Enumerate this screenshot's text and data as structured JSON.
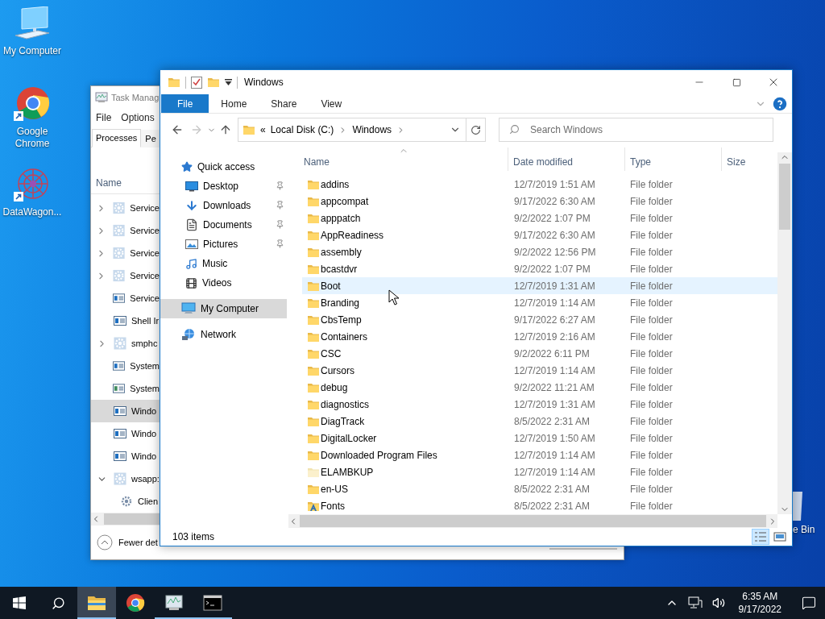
{
  "desktop_icons": [
    {
      "label": "My Computer",
      "kind": "computer"
    },
    {
      "label": "Google Chrome",
      "kind": "chrome"
    },
    {
      "label": "DataWagon...",
      "kind": "app"
    },
    {
      "label": "e Bin",
      "kind": "recycle"
    }
  ],
  "task_manager": {
    "title": "Task Manag",
    "menu": [
      "File",
      "Options"
    ],
    "tabs": [
      {
        "label": "Processes",
        "selected": true
      },
      {
        "label": "Pe",
        "selected": false
      }
    ],
    "column": "Name",
    "rows": [
      {
        "name": "Service",
        "kind": "group",
        "expanded": false,
        "selected": false
      },
      {
        "name": "Service",
        "kind": "group",
        "expanded": false,
        "selected": false
      },
      {
        "name": "Service",
        "kind": "group",
        "expanded": false,
        "selected": false
      },
      {
        "name": "Service",
        "kind": "group",
        "expanded": false,
        "selected": false
      },
      {
        "name": "Service",
        "kind": "app",
        "selected": false
      },
      {
        "name": "Shell Ir",
        "kind": "app",
        "selected": false
      },
      {
        "name": "smphc",
        "kind": "group",
        "expanded": false,
        "selected": false
      },
      {
        "name": "System",
        "kind": "app",
        "selected": false
      },
      {
        "name": "System",
        "kind": "app",
        "selected": false
      },
      {
        "name": "Windo",
        "kind": "app",
        "selected": true
      },
      {
        "name": "Windo",
        "kind": "app",
        "selected": false
      },
      {
        "name": "Windo",
        "kind": "app",
        "selected": false
      },
      {
        "name": "wsapp:",
        "kind": "group",
        "expanded": true,
        "selected": false,
        "children": [
          {
            "name": "Clien",
            "kind": "service",
            "selected": false
          }
        ]
      }
    ],
    "footer": "Fewer det"
  },
  "explorer": {
    "title": "Windows",
    "ribbon_tabs": [
      {
        "label": "File",
        "selected": true
      },
      {
        "label": "Home",
        "selected": false
      },
      {
        "label": "Share",
        "selected": false
      },
      {
        "label": "View",
        "selected": false
      }
    ],
    "address": {
      "prefix": "«",
      "crumbs": [
        "Local Disk (C:)",
        "Windows"
      ]
    },
    "search": {
      "placeholder": "Search Windows"
    },
    "nav": [
      {
        "label": "Quick access",
        "kind": "star",
        "selected": false,
        "children": [
          {
            "label": "Desktop",
            "kind": "desktop",
            "pinned": true,
            "selected": false
          },
          {
            "label": "Downloads",
            "kind": "downloads",
            "pinned": true,
            "selected": false
          },
          {
            "label": "Documents",
            "kind": "documents",
            "pinned": true,
            "selected": false
          },
          {
            "label": "Pictures",
            "kind": "pictures",
            "pinned": true,
            "selected": false
          },
          {
            "label": "Music",
            "kind": "music",
            "pinned": false,
            "selected": false
          },
          {
            "label": "Videos",
            "kind": "videos",
            "pinned": false,
            "selected": false
          }
        ]
      },
      {
        "label": "My Computer",
        "kind": "computer",
        "selected": true
      },
      {
        "label": "Network",
        "kind": "network",
        "selected": false
      }
    ],
    "columns": [
      "Name",
      "Date modified",
      "Type",
      "Size"
    ],
    "files": [
      {
        "name": "addins",
        "date": "12/7/2019 1:51 AM",
        "type": "File folder",
        "kind": "folder",
        "hovered": false
      },
      {
        "name": "appcompat",
        "date": "9/17/2022 6:30 AM",
        "type": "File folder",
        "kind": "folder",
        "hovered": false
      },
      {
        "name": "apppatch",
        "date": "9/2/2022 1:07 PM",
        "type": "File folder",
        "kind": "folder",
        "hovered": false
      },
      {
        "name": "AppReadiness",
        "date": "9/17/2022 6:30 AM",
        "type": "File folder",
        "kind": "folder",
        "hovered": false
      },
      {
        "name": "assembly",
        "date": "9/2/2022 12:56 PM",
        "type": "File folder",
        "kind": "folder",
        "hovered": false
      },
      {
        "name": "bcastdvr",
        "date": "9/2/2022 1:07 PM",
        "type": "File folder",
        "kind": "folder",
        "hovered": false
      },
      {
        "name": "Boot",
        "date": "12/7/2019 1:31 AM",
        "type": "File folder",
        "kind": "folder",
        "hovered": true
      },
      {
        "name": "Branding",
        "date": "12/7/2019 1:14 AM",
        "type": "File folder",
        "kind": "folder",
        "hovered": false
      },
      {
        "name": "CbsTemp",
        "date": "9/17/2022 6:27 AM",
        "type": "File folder",
        "kind": "folder",
        "hovered": false
      },
      {
        "name": "Containers",
        "date": "12/7/2019 2:16 AM",
        "type": "File folder",
        "kind": "folder",
        "hovered": false
      },
      {
        "name": "CSC",
        "date": "9/2/2022 6:11 PM",
        "type": "File folder",
        "kind": "folder",
        "hovered": false
      },
      {
        "name": "Cursors",
        "date": "12/7/2019 1:14 AM",
        "type": "File folder",
        "kind": "folder",
        "hovered": false
      },
      {
        "name": "debug",
        "date": "9/2/2022 11:21 AM",
        "type": "File folder",
        "kind": "folder",
        "hovered": false
      },
      {
        "name": "diagnostics",
        "date": "12/7/2019 1:31 AM",
        "type": "File folder",
        "kind": "folder",
        "hovered": false
      },
      {
        "name": "DiagTrack",
        "date": "8/5/2022 2:31 AM",
        "type": "File folder",
        "kind": "folder",
        "hovered": false
      },
      {
        "name": "DigitalLocker",
        "date": "12/7/2019 1:50 AM",
        "type": "File folder",
        "kind": "folder",
        "hovered": false
      },
      {
        "name": "Downloaded Program Files",
        "date": "12/7/2019 1:14 AM",
        "type": "File folder",
        "kind": "folder",
        "hovered": false
      },
      {
        "name": "ELAMBKUP",
        "date": "12/7/2019 1:14 AM",
        "type": "File folder",
        "kind": "hidden",
        "hovered": false
      },
      {
        "name": "en-US",
        "date": "8/5/2022 2:31 AM",
        "type": "File folder",
        "kind": "folder",
        "hovered": false
      },
      {
        "name": "Fonts",
        "date": "8/5/2022 2:31 AM",
        "type": "File folder",
        "kind": "fonts",
        "hovered": false
      }
    ],
    "status": "103 items",
    "view_modes": [
      {
        "kind": "details",
        "selected": true
      },
      {
        "kind": "tiles",
        "selected": false
      }
    ]
  },
  "taskbar": {
    "apps": [
      {
        "kind": "explorer",
        "active": true,
        "running": true
      },
      {
        "kind": "chrome",
        "active": false,
        "running": false
      },
      {
        "kind": "taskmgr",
        "active": false,
        "running": true
      },
      {
        "kind": "cmd",
        "active": false,
        "running": true
      }
    ],
    "time": "6:35 AM",
    "date": "9/17/2022"
  }
}
